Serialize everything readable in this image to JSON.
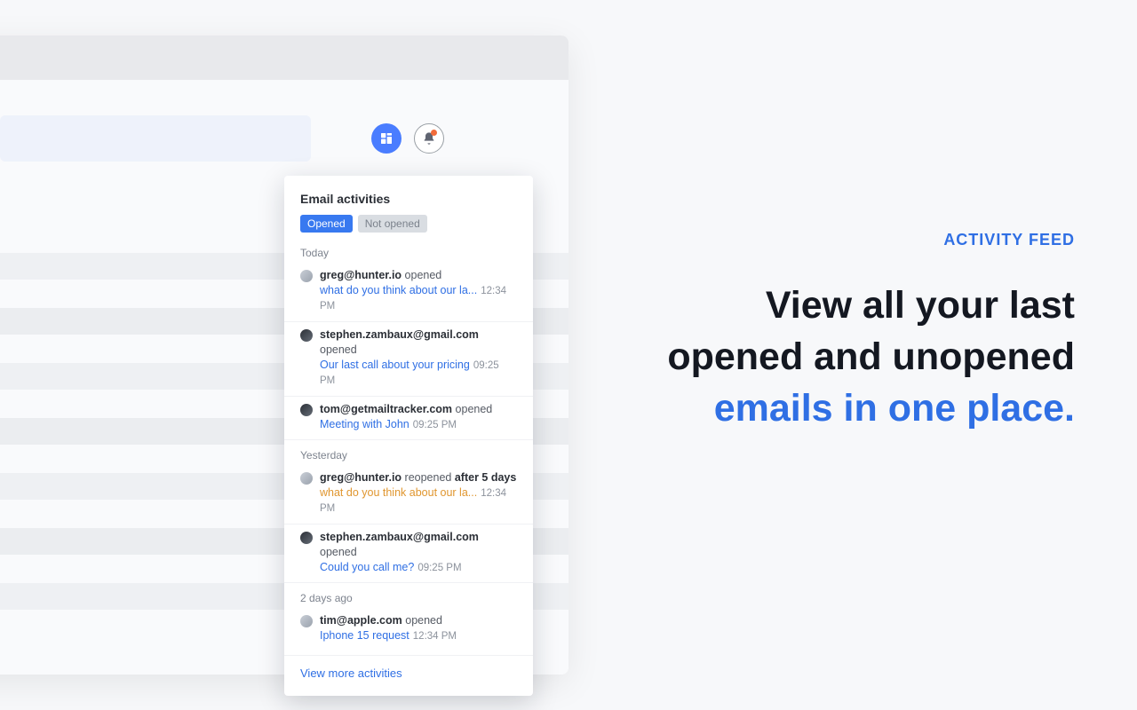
{
  "toolbar": {
    "dashboard_icon_name": "dashboard-icon",
    "bell_icon_name": "bell-icon"
  },
  "popover": {
    "title": "Email activities",
    "tabs": {
      "opened": "Opened",
      "not_opened": "Not opened"
    },
    "groups": [
      {
        "label": "Today",
        "items": [
          {
            "email": "greg@hunter.io",
            "action": "opened",
            "bold_suffix": "",
            "subject": "what do you think about our la...",
            "subject_color": "blue",
            "time": "12:34 PM",
            "avatar": "a1"
          },
          {
            "email": "stephen.zambaux@gmail.com",
            "action": "opened",
            "bold_suffix": "",
            "subject": "Our last call about your pricing",
            "subject_color": "blue",
            "time": "09:25 PM",
            "avatar": "a2"
          },
          {
            "email": "tom@getmailtracker.com",
            "action": "opened",
            "bold_suffix": "",
            "subject": "Meeting with John",
            "subject_color": "blue",
            "time": "09:25 PM",
            "avatar": "a2"
          }
        ]
      },
      {
        "label": "Yesterday",
        "items": [
          {
            "email": "greg@hunter.io",
            "action": "reopened",
            "bold_suffix": "after 5 days",
            "subject": "what do you think about our la...",
            "subject_color": "orange",
            "time": "12:34 PM",
            "avatar": "a1"
          },
          {
            "email": "stephen.zambaux@gmail.com",
            "action": "opened",
            "bold_suffix": "",
            "subject": "Could you call me?",
            "subject_color": "blue",
            "time": "09:25 PM",
            "avatar": "a2"
          }
        ]
      },
      {
        "label": "2 days ago",
        "items": [
          {
            "email": "tim@apple.com",
            "action": "opened",
            "bold_suffix": "",
            "subject": "Iphone 15 request",
            "subject_color": "blue",
            "time": "12:34 PM",
            "avatar": "a1"
          }
        ]
      }
    ],
    "view_more": "View more activities"
  },
  "promo": {
    "eyebrow": "ACTIVITY FEED",
    "line1": "View all your last",
    "line2": "opened and unopened",
    "line3": "emails in one place."
  }
}
